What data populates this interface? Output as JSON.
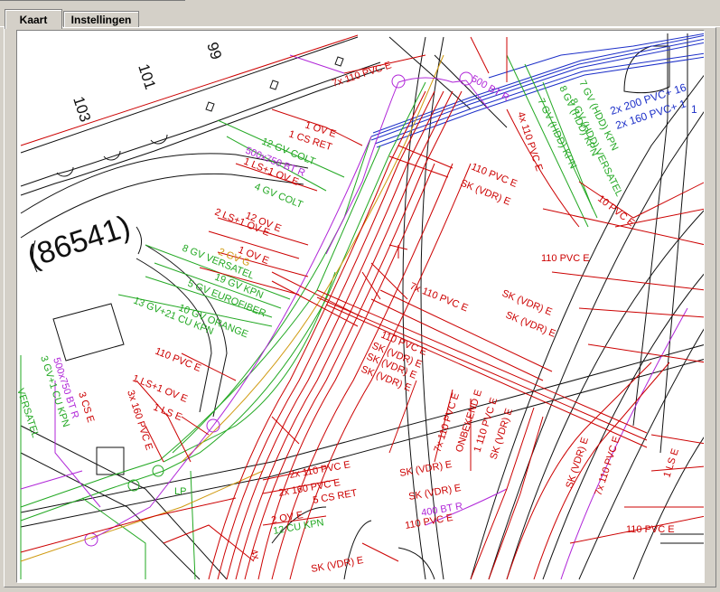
{
  "tabs": [
    {
      "label": "Kaart",
      "active": true
    },
    {
      "label": "Instellingen",
      "active": false
    }
  ],
  "map": {
    "parcel_number": "(86541)",
    "house_numbers": [
      "103",
      "101",
      "99"
    ],
    "colors": {
      "red": "#cc0000",
      "green": "#22a822",
      "blue": "#1c2fc8",
      "magenta": "#b026d8",
      "orange": "#d09a10",
      "black": "#111111"
    },
    "labels": {
      "l01": "7x 110 PVC E",
      "l02": "500 BT R",
      "l03": "1 OV E",
      "l04": "1 CS RET",
      "l05": "12 GV COLT",
      "l06": "500x750 BT R",
      "l07": "1 LS+1 OV E",
      "l08": "4 GV COLT",
      "l09": "12 OV E",
      "l10": "2 LS+1 OV E",
      "l11": "1 OV E",
      "l12": "2 GV G",
      "l13": "8 GV VERSATEL",
      "l14": "19 GV KPN",
      "l15": "5 GV EUROFIBER",
      "l16": "10 GV ORANGE",
      "l17": "13 GV+21 CU KPN",
      "l18": "110 PVC E",
      "l19": "1 LS+1 OV E",
      "l20": "3x 160 PVC E",
      "l21": "1 LS E",
      "l22": "3 GV+1 CU KPN",
      "l23": "500x750 BT R",
      "l24": "3 CS E",
      "l25": "VERSATEL",
      "l26": "4x 110 PVC E",
      "l27": "7 GV (HDD) KPN",
      "l28": "8 GV (HDD) KPN",
      "l29": "8 GV (HDD) VERSATEL",
      "l30": "7 GV (HDD) KPN",
      "l31": "110 PVC E",
      "l32": "SK (VDR) E",
      "l33": "2x 200 PVC+ 16",
      "l34": "2x 160 PVC+ 1",
      "l35": "10 PVC E",
      "l36": "110 PVC E",
      "l37": "7x 110 PVC E",
      "l38": "SK (VDR) E",
      "l39": "SK (VDR) E",
      "l40": "110 PVC E",
      "l41": "SK (VDR) E",
      "l42": "SK (VDR) E",
      "l43": "SK (VDR) E",
      "l44": "7x 110 PVC E",
      "l45": "ONBEKEND E",
      "l46": "1 110 PVC E",
      "l47": "SK (VDR) E",
      "l48": "SK (VDR) E",
      "l49": "7x 110 PVC E",
      "l50": "1 LS E",
      "l51": "2x 110 PVC E",
      "l52": "2x 160 PVC E",
      "l53": "5 CS RET",
      "l54": "2 OV E",
      "l55": "12 CU KPN",
      "l56": "SK (VDR) E",
      "l57": "SK (VDR) E",
      "l58": "400 BT R",
      "l59": "110 PVC E",
      "l60": "110 PVC E",
      "l61": "SK (VDR) E",
      "l62": "LP",
      "l63": "4x",
      "l64": "1"
    }
  }
}
